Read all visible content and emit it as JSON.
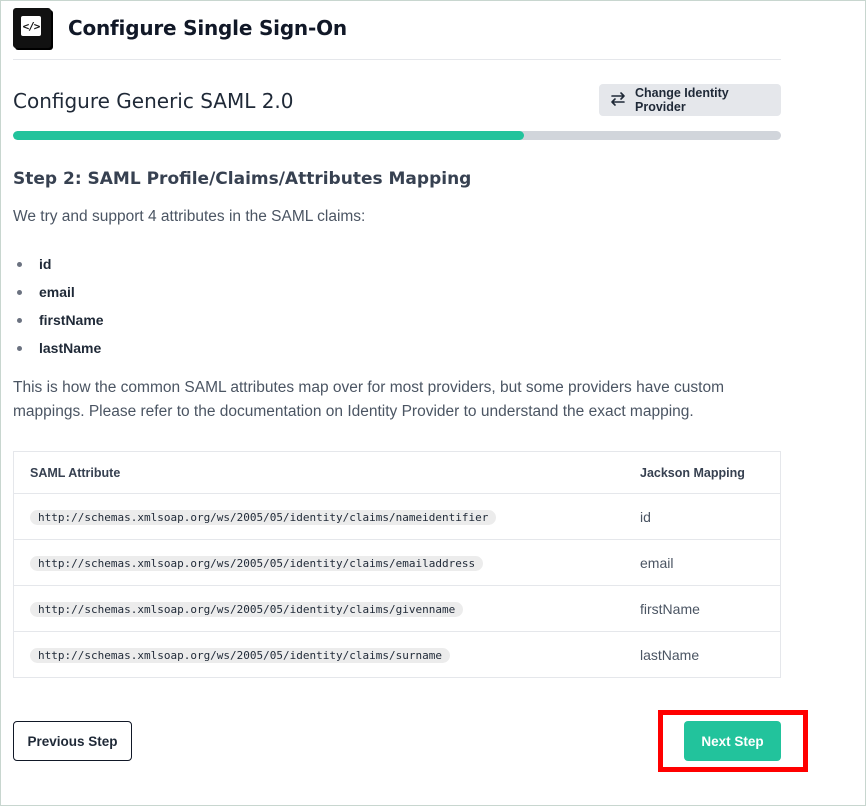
{
  "header": {
    "logo_text": "</>",
    "title": "Configure Single Sign-On"
  },
  "page": {
    "heading": "Configure Generic SAML 2.0",
    "change_provider_label": "Change Identity Provider",
    "progress_fraction": 0.665
  },
  "step": {
    "title": "Step 2: SAML Profile/Claims/Attributes Mapping",
    "intro": "We try and support 4 attributes in the SAML claims:",
    "attributes": [
      "id",
      "email",
      "firstName",
      "lastName"
    ],
    "description": "This is how the common SAML attributes map over for most providers, but some providers have custom mappings. Please refer to the documentation on Identity Provider to understand the exact mapping."
  },
  "table": {
    "headers": [
      "SAML Attribute",
      "Jackson Mapping"
    ],
    "rows": [
      {
        "attribute": "http://schemas.xmlsoap.org/ws/2005/05/identity/claims/nameidentifier",
        "mapping": "id"
      },
      {
        "attribute": "http://schemas.xmlsoap.org/ws/2005/05/identity/claims/emailaddress",
        "mapping": "email"
      },
      {
        "attribute": "http://schemas.xmlsoap.org/ws/2005/05/identity/claims/givenname",
        "mapping": "firstName"
      },
      {
        "attribute": "http://schemas.xmlsoap.org/ws/2005/05/identity/claims/surname",
        "mapping": "lastName"
      }
    ]
  },
  "footer": {
    "previous_label": "Previous Step",
    "next_label": "Next Step"
  },
  "colors": {
    "accent": "#22c39c",
    "highlight": "#ff0000"
  }
}
